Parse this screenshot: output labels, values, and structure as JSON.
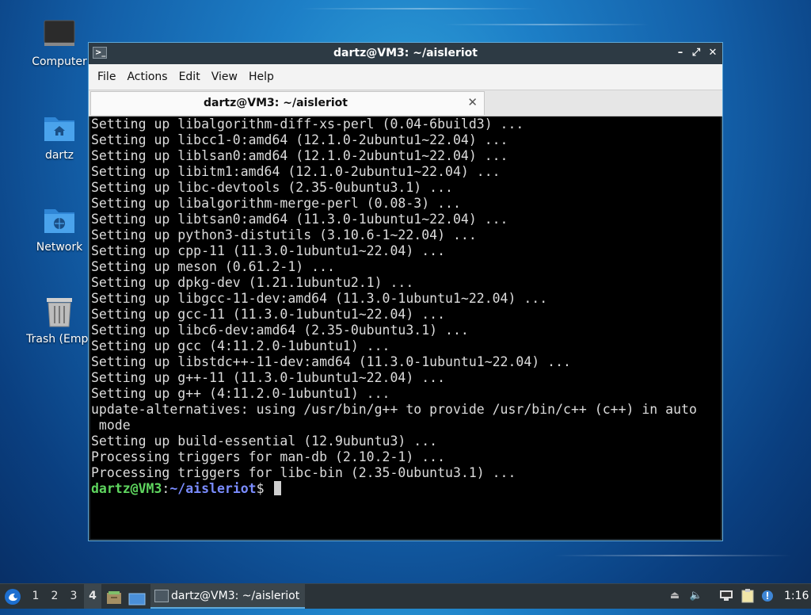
{
  "desktop": {
    "icons": [
      {
        "label": "Computer"
      },
      {
        "label": "dartz"
      },
      {
        "label": "Network"
      },
      {
        "label": "Trash (Empt"
      }
    ]
  },
  "window": {
    "title": "dartz@VM3: ~/aisleriot",
    "menu": [
      "File",
      "Actions",
      "Edit",
      "View",
      "Help"
    ],
    "tab_title": "dartz@VM3: ~/aisleriot"
  },
  "terminal": {
    "lines": [
      "Setting up libalgorithm-diff-xs-perl (0.04-6build3) ...",
      "Setting up libcc1-0:amd64 (12.1.0-2ubuntu1~22.04) ...",
      "Setting up liblsan0:amd64 (12.1.0-2ubuntu1~22.04) ...",
      "Setting up libitm1:amd64 (12.1.0-2ubuntu1~22.04) ...",
      "Setting up libc-devtools (2.35-0ubuntu3.1) ...",
      "Setting up libalgorithm-merge-perl (0.08-3) ...",
      "Setting up libtsan0:amd64 (11.3.0-1ubuntu1~22.04) ...",
      "Setting up python3-distutils (3.10.6-1~22.04) ...",
      "Setting up cpp-11 (11.3.0-1ubuntu1~22.04) ...",
      "Setting up meson (0.61.2-1) ...",
      "Setting up dpkg-dev (1.21.1ubuntu2.1) ...",
      "Setting up libgcc-11-dev:amd64 (11.3.0-1ubuntu1~22.04) ...",
      "Setting up gcc-11 (11.3.0-1ubuntu1~22.04) ...",
      "Setting up libc6-dev:amd64 (2.35-0ubuntu3.1) ...",
      "Setting up gcc (4:11.2.0-1ubuntu1) ...",
      "Setting up libstdc++-11-dev:amd64 (11.3.0-1ubuntu1~22.04) ...",
      "Setting up g++-11 (11.3.0-1ubuntu1~22.04) ...",
      "Setting up g++ (4:11.2.0-1ubuntu1) ...",
      "update-alternatives: using /usr/bin/g++ to provide /usr/bin/c++ (c++) in auto",
      " mode",
      "Setting up build-essential (12.9ubuntu3) ...",
      "Processing triggers for man-db (2.10.2-1) ...",
      "Processing triggers for libc-bin (2.35-0ubuntu3.1) ..."
    ],
    "prompt_user": "dartz@VM3",
    "prompt_sep": ":",
    "prompt_path": "~/aisleriot",
    "prompt_end": "$ "
  },
  "taskbar": {
    "workspaces": [
      "1",
      "2",
      "3",
      "4"
    ],
    "active_workspace": "4",
    "task_label": "dartz@VM3: ~/aisleriot",
    "clock": "1:16"
  },
  "colors": {
    "prompt_user": "#5ed55e",
    "prompt_path": "#7a8cff",
    "window_border": "#5fa8d8"
  }
}
